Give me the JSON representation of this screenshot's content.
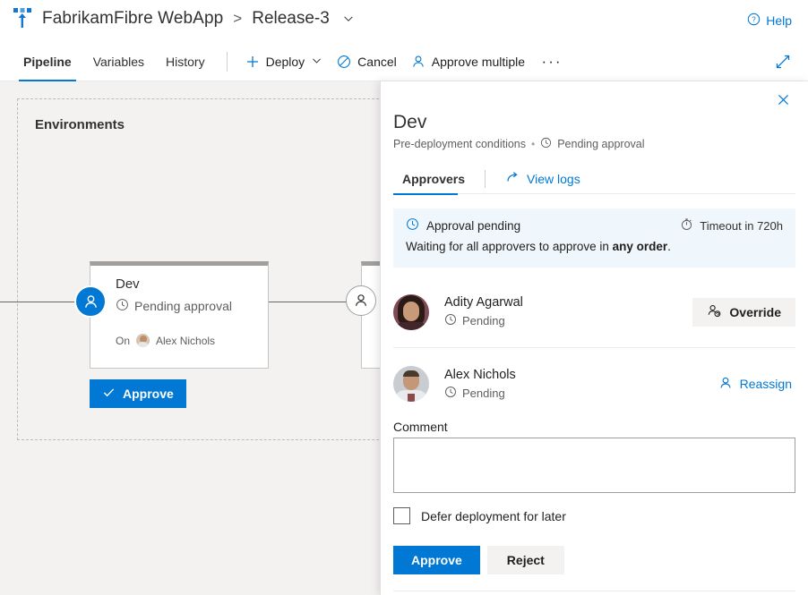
{
  "header": {
    "logo_icon": "azure-pipelines-icon",
    "project_name": "FabrikamFibre WebApp",
    "breadcrumb_separator": ">",
    "release_name": "Release-3",
    "release_chevron_icon": "chevron-down-icon",
    "help_label": "Help",
    "help_icon": "help-circle-icon"
  },
  "commandbar": {
    "tabs": [
      {
        "label": "Pipeline",
        "active": true
      },
      {
        "label": "Variables",
        "active": false
      },
      {
        "label": "History",
        "active": false
      }
    ],
    "deploy_label": "Deploy",
    "deploy_icon": "plus-icon",
    "deploy_chevron_icon": "chevron-down-icon",
    "cancel_label": "Cancel",
    "cancel_icon": "cancel-circle-icon",
    "approve_multiple_label": "Approve multiple",
    "approve_multiple_icon": "person-icon",
    "more_label": "···",
    "expand_icon": "expand-diagonal-icon"
  },
  "canvas": {
    "environments_title": "Environments",
    "stage": {
      "name": "Dev",
      "status": "Pending approval",
      "status_icon": "clock-icon",
      "owner_prefix": "On",
      "owner_name": "Alex Nichols",
      "owner_avatar": "avatar-alex-nichols",
      "pre_approval_icon": "person-icon",
      "post_approval_icon": "person-icon"
    },
    "approve_cta_label": "Approve",
    "approve_cta_icon": "checkmark-icon"
  },
  "panel": {
    "close_icon": "close-icon",
    "title": "Dev",
    "subtitle_conditions": "Pre-deployment conditions",
    "subtitle_dot": "•",
    "subtitle_status_icon": "clock-icon",
    "subtitle_status": "Pending approval",
    "tabs": {
      "approvers_label": "Approvers",
      "view_logs_label": "View logs",
      "view_logs_icon": "open-link-arrow-icon"
    },
    "banner": {
      "icon": "clock-icon",
      "title": "Approval pending",
      "timeout_icon": "stopwatch-icon",
      "timeout_label": "Timeout in 720h",
      "detail_prefix": "Waiting for all approvers to approve in ",
      "detail_strong": "any order",
      "detail_suffix": "."
    },
    "approvers": [
      {
        "name": "Adity Agarwal",
        "status": "Pending",
        "status_icon": "clock-icon",
        "avatar": "avatar-adity-agarwal",
        "action_label": "Override",
        "action_icon": "person-override-icon",
        "action_type": "button"
      },
      {
        "name": "Alex Nichols",
        "status": "Pending",
        "status_icon": "clock-icon",
        "avatar": "avatar-alex-nichols",
        "action_label": "Reassign",
        "action_icon": "person-icon",
        "action_type": "link"
      }
    ],
    "comment": {
      "label": "Comment",
      "value": "",
      "placeholder": ""
    },
    "defer": {
      "label": "Defer deployment for later",
      "checked": false
    },
    "actions": {
      "approve_label": "Approve",
      "reject_label": "Reject"
    }
  },
  "colors": {
    "accent": "#0078d4",
    "banner_bg": "#eff6fc",
    "canvas_bg": "#f3f2f1",
    "neutral_btn": "#f3f2f1",
    "stage_header": "#a19f9d"
  }
}
